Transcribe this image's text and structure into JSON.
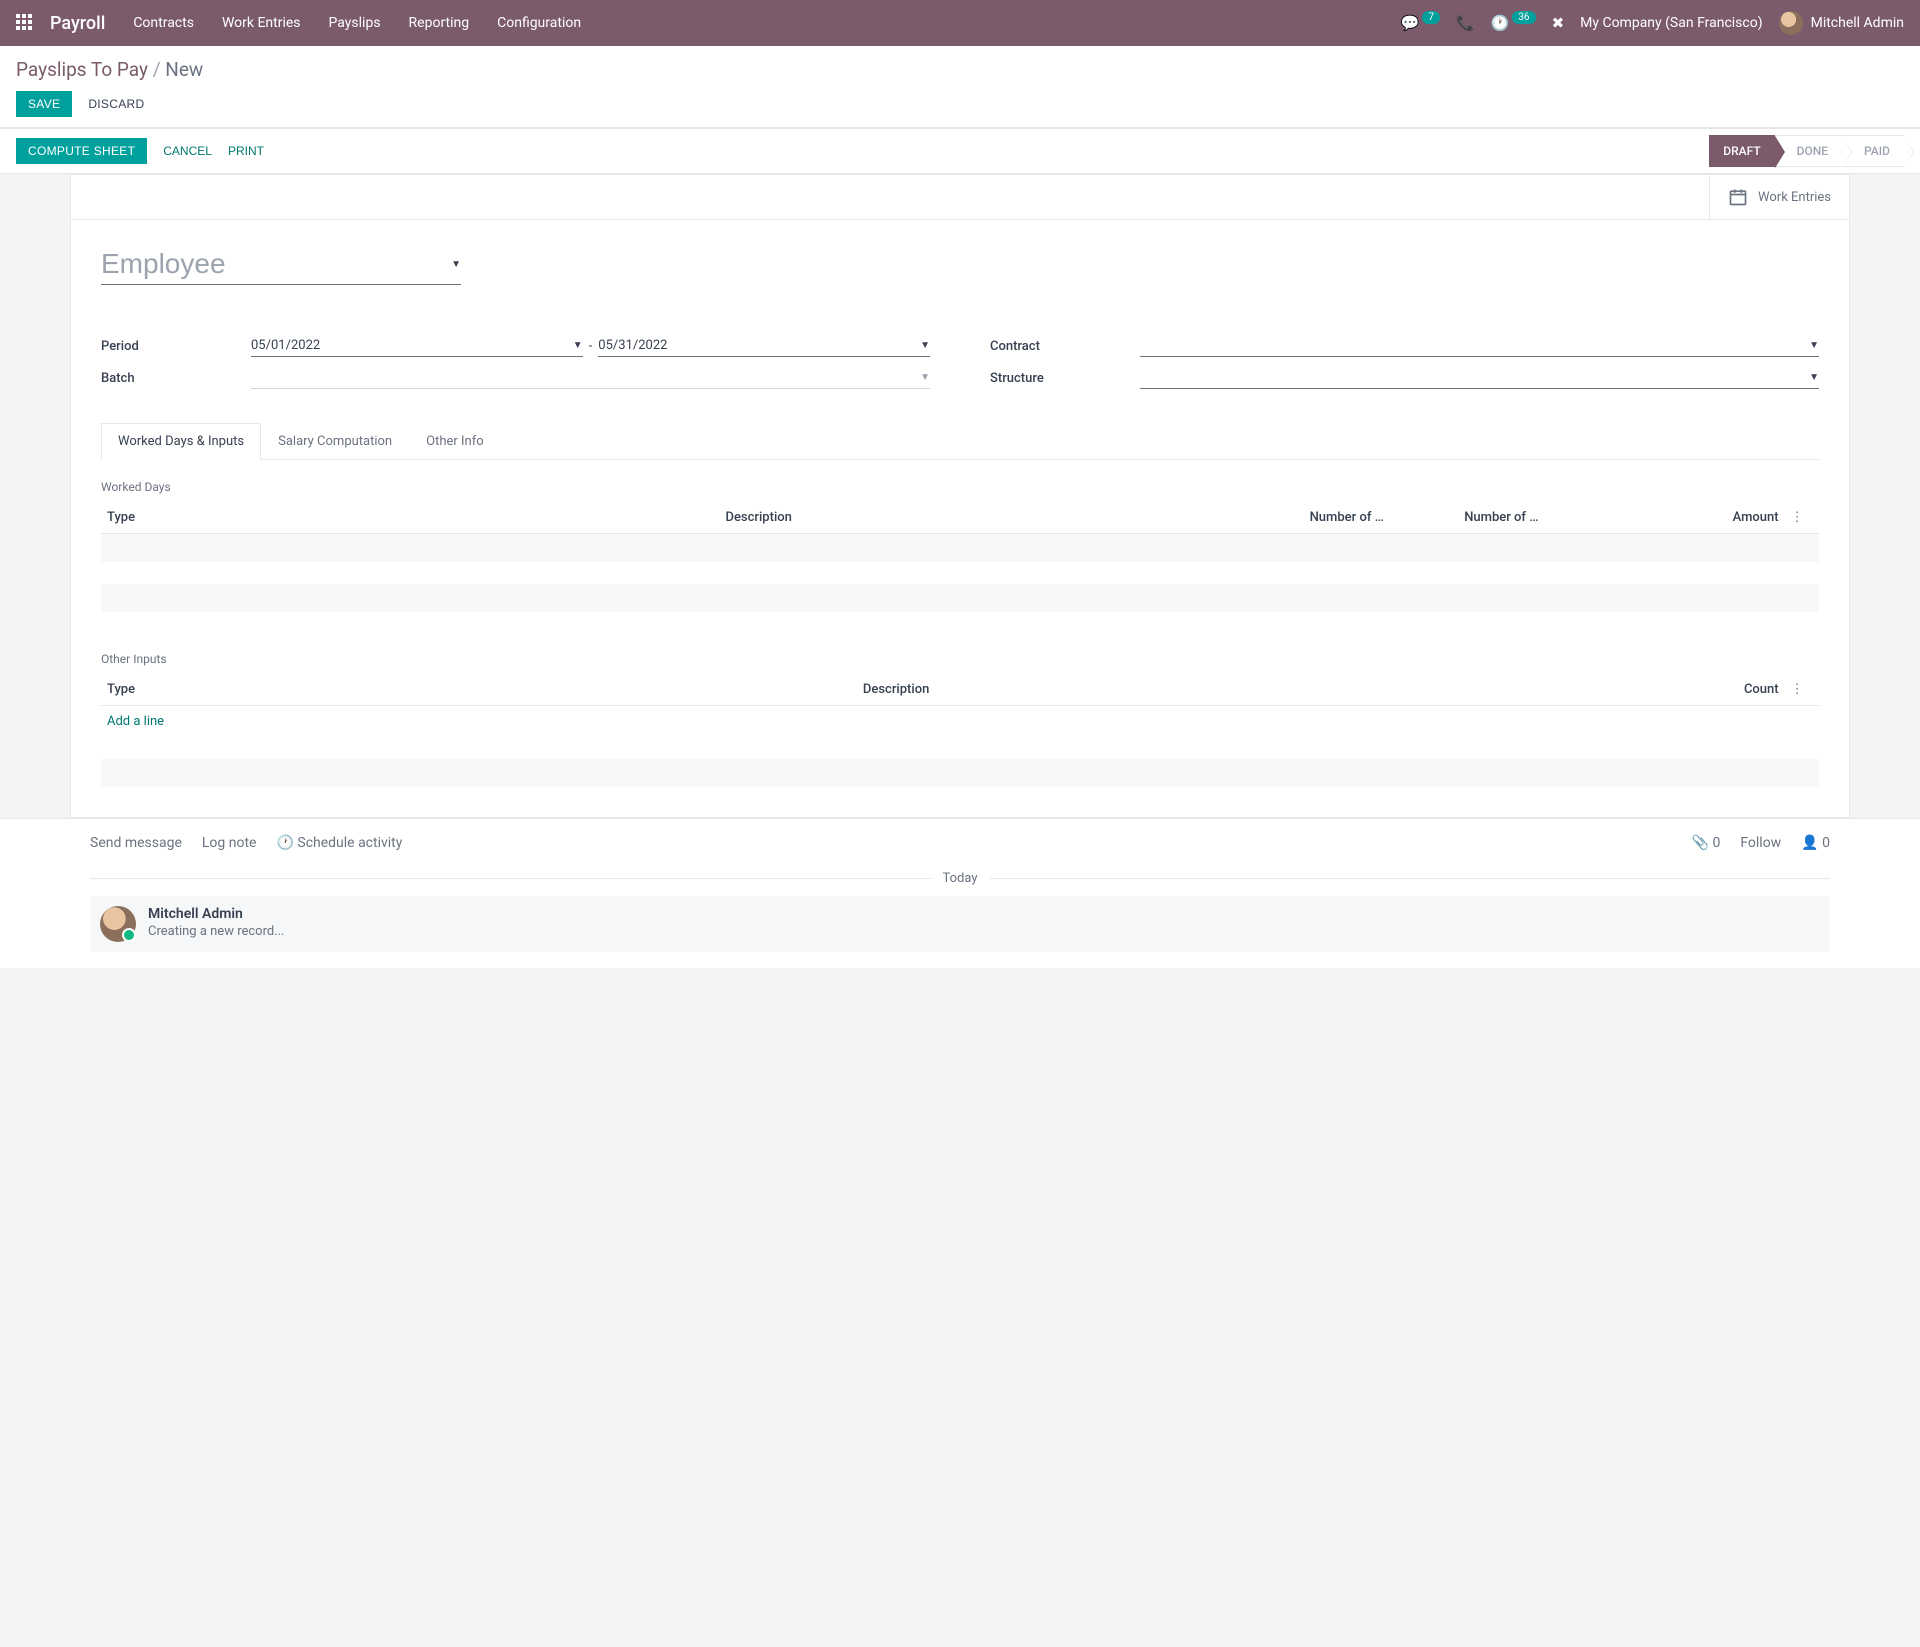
{
  "navbar": {
    "brand": "Payroll",
    "menu": [
      "Contracts",
      "Work Entries",
      "Payslips",
      "Reporting",
      "Configuration"
    ],
    "chat_badge": "7",
    "activity_badge": "36",
    "company": "My Company (San Francisco)",
    "user": "Mitchell Admin"
  },
  "breadcrumb": {
    "parent": "Payslips To Pay",
    "current": "New"
  },
  "buttons": {
    "save": "SAVE",
    "discard": "DISCARD",
    "compute": "COMPUTE SHEET",
    "cancel": "CANCEL",
    "print": "PRINT"
  },
  "status": [
    "DRAFT",
    "DONE",
    "PAID"
  ],
  "status_active_index": 0,
  "smart_button": {
    "work_entries": "Work Entries"
  },
  "form": {
    "employee_placeholder": "Employee",
    "period_label": "Period",
    "period_from": "05/01/2022",
    "period_to": "05/31/2022",
    "period_sep": "-",
    "batch_label": "Batch",
    "batch_value": "",
    "contract_label": "Contract",
    "contract_value": "",
    "structure_label": "Structure",
    "structure_value": ""
  },
  "tabs": [
    "Worked Days & Inputs",
    "Salary Computation",
    "Other Info"
  ],
  "tabs_active_index": 0,
  "worked_days": {
    "title": "Worked Days",
    "cols": {
      "type": "Type",
      "desc": "Description",
      "days": "Number of …",
      "hours": "Number of …",
      "amount": "Amount"
    }
  },
  "other_inputs": {
    "title": "Other Inputs",
    "cols": {
      "type": "Type",
      "desc": "Description",
      "count": "Count"
    },
    "add_line": "Add a line"
  },
  "chatter": {
    "send": "Send message",
    "log": "Log note",
    "schedule": "Schedule activity",
    "attach_count": "0",
    "follow": "Follow",
    "follower_count": "0",
    "today": "Today",
    "msg_author": "Mitchell Admin",
    "msg_text": "Creating a new record..."
  }
}
